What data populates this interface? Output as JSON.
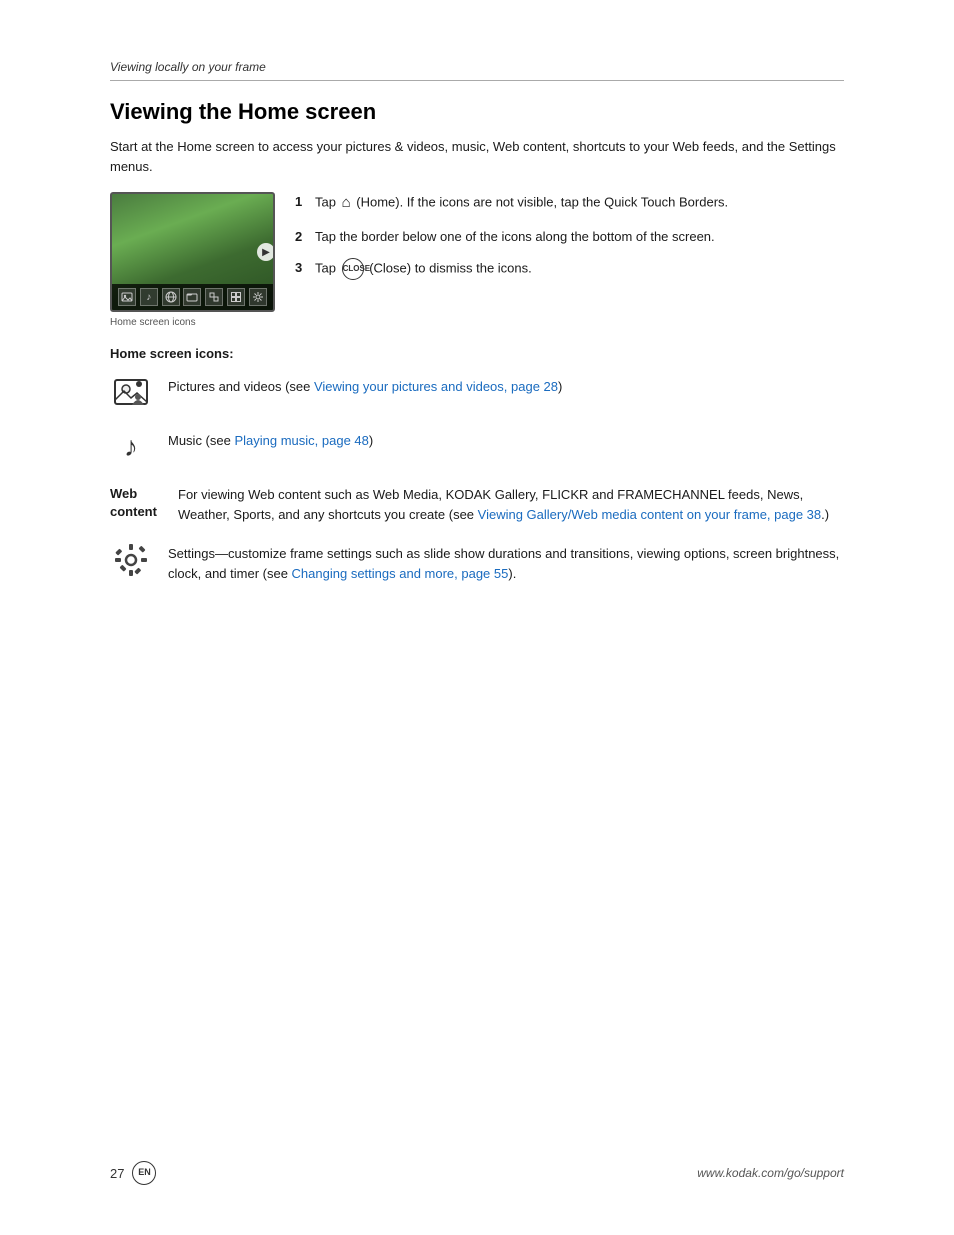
{
  "section_label": "Viewing locally on your frame",
  "heading": "Viewing the Home screen",
  "intro": "Start at the Home screen to access your pictures & videos, music, Web content, shortcuts to your Web feeds, and the Settings menus.",
  "steps": [
    {
      "num": "1",
      "text_before": "Tap",
      "icon": "home",
      "text_after": "(Home). If the icons are not visible, tap the Quick Touch Borders."
    },
    {
      "num": "2",
      "text": "Tap the border below one of the icons along the bottom of the screen."
    },
    {
      "num": "3",
      "text_before": "Tap",
      "icon": "close",
      "text_after": "(Close) to dismiss the icons."
    }
  ],
  "frame_caption": "Home screen icons",
  "icons_heading": "Home screen icons:",
  "icon_rows": [
    {
      "id": "photos",
      "label": "",
      "desc": "Pictures and videos (see ",
      "link_text": "Viewing your pictures and videos, page 28",
      "desc_after": ")"
    },
    {
      "id": "music",
      "label": "",
      "desc": "Music (see ",
      "link_text": "Playing music, page 48",
      "desc_after": ")"
    }
  ],
  "web_content": {
    "label_line1": "Web",
    "label_line2": "content",
    "desc": "For viewing Web content such as Web Media, KODAK Gallery, FLICKR and FRAMECHANNEL feeds, News, Weather, Sports, and any shortcuts you create (see ",
    "link_text": "Viewing Gallery/Web media content on your frame, page 38",
    "desc_after": ".)"
  },
  "settings_row": {
    "desc": "Settings—customize frame settings such as slide show durations and transitions, viewing options, screen brightness, clock, and timer (see ",
    "link_text": "Changing settings and more, page 55",
    "desc_after": ")."
  },
  "page_number": "27",
  "en_label": "EN",
  "website": "www.kodak.com/go/support"
}
